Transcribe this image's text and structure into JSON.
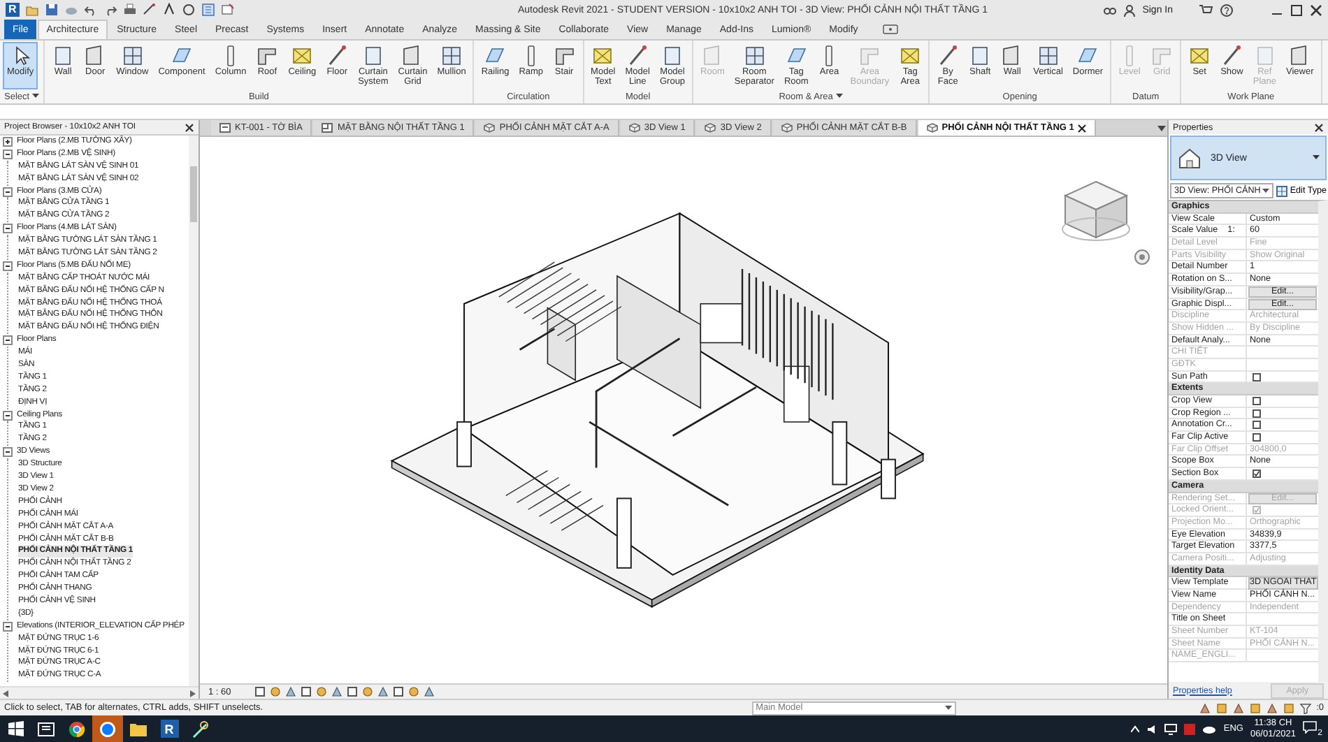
{
  "window": {
    "logo": "R",
    "title": "Autodesk Revit 2021 - STUDENT VERSION - 10x10x2 ANH TOI - 3D View: PHỐI CẢNH NỘI THẤT TẦNG 1",
    "sign_in": "Sign In"
  },
  "ribbon_tabs": [
    {
      "label": "File",
      "kind": "file",
      "selected": false
    },
    {
      "label": "Architecture",
      "kind": "tab",
      "selected": true
    },
    {
      "label": "Structure",
      "kind": "tab",
      "selected": false
    },
    {
      "label": "Steel",
      "kind": "tab",
      "selected": false
    },
    {
      "label": "Precast",
      "kind": "tab",
      "selected": false
    },
    {
      "label": "Systems",
      "kind": "tab",
      "selected": false
    },
    {
      "label": "Insert",
      "kind": "tab",
      "selected": false
    },
    {
      "label": "Annotate",
      "kind": "tab",
      "selected": false
    },
    {
      "label": "Analyze",
      "kind": "tab",
      "selected": false
    },
    {
      "label": "Massing & Site",
      "kind": "tab",
      "selected": false
    },
    {
      "label": "Collaborate",
      "kind": "tab",
      "selected": false
    },
    {
      "label": "View",
      "kind": "tab",
      "selected": false
    },
    {
      "label": "Manage",
      "kind": "tab",
      "selected": false
    },
    {
      "label": "Add-Ins",
      "kind": "tab",
      "selected": false
    },
    {
      "label": "Lumion®",
      "kind": "tab",
      "selected": false
    },
    {
      "label": "Modify",
      "kind": "tab",
      "selected": false
    }
  ],
  "ribbon_panels": [
    {
      "title": "Select",
      "menu": true,
      "tools": [
        {
          "label": "Modify",
          "selected": true,
          "disabled": false
        }
      ]
    },
    {
      "title": "Build",
      "menu": false,
      "tools": [
        {
          "label": "Wall",
          "selected": false,
          "disabled": false
        },
        {
          "label": "Door",
          "selected": false,
          "disabled": false
        },
        {
          "label": "Window",
          "selected": false,
          "disabled": false
        },
        {
          "label": "Component",
          "selected": false,
          "disabled": false
        },
        {
          "label": "Column",
          "selected": false,
          "disabled": false
        },
        {
          "label": "Roof",
          "selected": false,
          "disabled": false
        },
        {
          "label": "Ceiling",
          "selected": false,
          "disabled": false
        },
        {
          "label": "Floor",
          "selected": false,
          "disabled": false
        },
        {
          "label": "Curtain System",
          "selected": false,
          "disabled": false
        },
        {
          "label": "Curtain Grid",
          "selected": false,
          "disabled": false
        },
        {
          "label": "Mullion",
          "selected": false,
          "disabled": false
        }
      ]
    },
    {
      "title": "Circulation",
      "menu": false,
      "tools": [
        {
          "label": "Railing",
          "selected": false,
          "disabled": false
        },
        {
          "label": "Ramp",
          "selected": false,
          "disabled": false
        },
        {
          "label": "Stair",
          "selected": false,
          "disabled": false
        }
      ]
    },
    {
      "title": "Model",
      "menu": false,
      "tools": [
        {
          "label": "Model Text",
          "selected": false,
          "disabled": false
        },
        {
          "label": "Model Line",
          "selected": false,
          "disabled": false
        },
        {
          "label": "Model Group",
          "selected": false,
          "disabled": false
        }
      ]
    },
    {
      "title": "Room & Area",
      "menu": true,
      "tools": [
        {
          "label": "Room",
          "selected": false,
          "disabled": true
        },
        {
          "label": "Room Separator",
          "selected": false,
          "disabled": false
        },
        {
          "label": "Tag Room",
          "selected": false,
          "disabled": false
        },
        {
          "label": "Area",
          "selected": false,
          "disabled": false
        },
        {
          "label": "Area Boundary",
          "selected": false,
          "disabled": true
        },
        {
          "label": "Tag Area",
          "selected": false,
          "disabled": false
        }
      ]
    },
    {
      "title": "Opening",
      "menu": false,
      "tools": [
        {
          "label": "By Face",
          "selected": false,
          "disabled": false
        },
        {
          "label": "Shaft",
          "selected": false,
          "disabled": false
        },
        {
          "label": "Wall",
          "selected": false,
          "disabled": false
        },
        {
          "label": "Vertical",
          "selected": false,
          "disabled": false
        },
        {
          "label": "Dormer",
          "selected": false,
          "disabled": false
        }
      ]
    },
    {
      "title": "Datum",
      "menu": false,
      "tools": [
        {
          "label": "Level",
          "selected": false,
          "disabled": true
        },
        {
          "label": "Grid",
          "selected": false,
          "disabled": true
        }
      ]
    },
    {
      "title": "Work Plane",
      "menu": false,
      "tools": [
        {
          "label": "Set",
          "selected": false,
          "disabled": false
        },
        {
          "label": "Show",
          "selected": false,
          "disabled": false
        },
        {
          "label": "Ref Plane",
          "selected": false,
          "disabled": true
        },
        {
          "label": "Viewer",
          "selected": false,
          "disabled": false
        }
      ]
    }
  ],
  "project_browser": {
    "title": "Project Browser - 10x10x2 ANH TOI",
    "tree": [
      {
        "label": "Floor Plans (2.MB TƯỜNG XÂY)",
        "expanded": false,
        "selected": false
      },
      {
        "label": "Floor Plans (2.MB VỆ SINH)",
        "expanded": true,
        "selected": false,
        "children": [
          {
            "label": "MẶT BẰNG LÁT SÀN VỆ SINH 01",
            "selected": false
          },
          {
            "label": "MẶT BẰNG LÁT SÀN VỆ SINH 02",
            "selected": false
          }
        ]
      },
      {
        "label": "Floor Plans (3.MB CỬA)",
        "expanded": true,
        "selected": false,
        "children": [
          {
            "label": "MẶT BẰNG CỬA TẦNG 1",
            "selected": false
          },
          {
            "label": "MẶT BẰNG CỬA TẦNG 2",
            "selected": false
          }
        ]
      },
      {
        "label": "Floor Plans (4.MB LÁT SÀN)",
        "expanded": true,
        "selected": false,
        "children": [
          {
            "label": "MẶT BẰNG TƯỜNG LÁT SÀN TẦNG 1",
            "selected": false
          },
          {
            "label": "MẶT BẰNG TƯỜNG LÁT SÀN TẦNG 2",
            "selected": false
          }
        ]
      },
      {
        "label": "Floor Plans (5.MB ĐẤU NỐI ME)",
        "expanded": true,
        "selected": false,
        "children": [
          {
            "label": "MẶT BẰNG CẤP THOÁT NƯỚC MÁI",
            "selected": false
          },
          {
            "label": "MẶT BẰNG ĐẤU NỐI HỆ THỐNG CẤP N",
            "selected": false
          },
          {
            "label": "MẶT BẰNG ĐẤU NỐI HỆ THỐNG THOÁ",
            "selected": false
          },
          {
            "label": "MẶT BẰNG ĐẤU NỐI HỆ THỐNG THÔN",
            "selected": false
          },
          {
            "label": "MẶT BẰNG ĐẤU NỐI HỆ THỐNG ĐIỆN",
            "selected": false
          }
        ]
      },
      {
        "label": "Floor Plans",
        "expanded": true,
        "selected": false,
        "children": [
          {
            "label": "MÁI",
            "selected": false
          },
          {
            "label": "SÀN",
            "selected": false
          },
          {
            "label": "TẦNG 1",
            "selected": false
          },
          {
            "label": "TẦNG 2",
            "selected": false
          },
          {
            "label": "ĐỊNH VỊ",
            "selected": false
          }
        ]
      },
      {
        "label": "Ceiling Plans",
        "expanded": true,
        "selected": false,
        "children": [
          {
            "label": "TẦNG 1",
            "selected": false
          },
          {
            "label": "TẦNG 2",
            "selected": false
          }
        ]
      },
      {
        "label": "3D Views",
        "expanded": true,
        "selected": false,
        "children": [
          {
            "label": "3D Structure",
            "selected": false
          },
          {
            "label": "3D View 1",
            "selected": false
          },
          {
            "label": "3D View 2",
            "selected": false
          },
          {
            "label": "PHỐI CẢNH",
            "selected": false
          },
          {
            "label": "PHỐI CẢNH MÁI",
            "selected": false
          },
          {
            "label": "PHỐI CẢNH MẶT CẮT A-A",
            "selected": false
          },
          {
            "label": "PHỐI CẢNH MẶT CẮT B-B",
            "selected": false
          },
          {
            "label": "PHỐI CẢNH NỘI THẤT TẦNG 1",
            "selected": true
          },
          {
            "label": "PHỐI CẢNH NỘI THẤT TẦNG 2",
            "selected": false
          },
          {
            "label": "PHỐI CẢNH TAM CẤP",
            "selected": false
          },
          {
            "label": "PHỐI CẢNH THANG",
            "selected": false
          },
          {
            "label": "PHỐI CẢNH VỆ SINH",
            "selected": false
          },
          {
            "label": "{3D}",
            "selected": false
          }
        ]
      },
      {
        "label": "Elevations (INTERIOR_ELEVATION CẤP PHÉP",
        "expanded": true,
        "selected": false,
        "children": [
          {
            "label": "MẶT ĐỨNG TRỤC 1-6",
            "selected": false
          },
          {
            "label": "MẶT ĐỨNG TRỤC 6-1",
            "selected": false
          },
          {
            "label": "MẶT ĐỨNG TRỤC A-C",
            "selected": false
          },
          {
            "label": "MẶT ĐỨNG TRỤC C-A",
            "selected": false
          }
        ]
      }
    ]
  },
  "view_tabs": [
    {
      "label": "KT-001 - TỜ BÌA",
      "kind": "sheet",
      "selected": false
    },
    {
      "label": "MẶT BẰNG NỘI THẤT TẦNG 1",
      "kind": "plan",
      "selected": false
    },
    {
      "label": "PHỐI CẢNH MẶT CẮT A-A",
      "kind": "model",
      "selected": false
    },
    {
      "label": "3D View 1",
      "kind": "model",
      "selected": false
    },
    {
      "label": "3D View 2",
      "kind": "model",
      "selected": false
    },
    {
      "label": "PHỐI CẢNH MẶT CẮT B-B",
      "kind": "model",
      "selected": false
    },
    {
      "label": "PHỐI CẢNH NỘI THẤT TẦNG 1",
      "kind": "model",
      "selected": true
    }
  ],
  "view_control_bar": {
    "scale": "1 : 60"
  },
  "properties": {
    "title": "Properties",
    "type": "3D View",
    "selector": "3D View: PHỐI CẢNH",
    "edit_type": "Edit Type",
    "groups": [
      {
        "title": "Graphics",
        "rows": [
          {
            "name": "View Scale",
            "value": "Custom",
            "kind": "text",
            "disabled": false
          },
          {
            "name": "Scale Value    1:",
            "value": "60",
            "kind": "text",
            "disabled": false
          },
          {
            "name": "Detail Level",
            "value": "Fine",
            "kind": "text",
            "disabled": true
          },
          {
            "name": "Parts Visibility",
            "value": "Show Original",
            "kind": "text",
            "disabled": true
          },
          {
            "name": "Detail Number",
            "value": "1",
            "kind": "text",
            "disabled": false
          },
          {
            "name": "Rotation on S...",
            "value": "None",
            "kind": "text",
            "disabled": false
          },
          {
            "name": "Visibility/Grap...",
            "value": "Edit...",
            "kind": "button",
            "disabled": false
          },
          {
            "name": "Graphic Displ...",
            "value": "Edit...",
            "kind": "button",
            "disabled": false
          },
          {
            "name": "Discipline",
            "value": "Architectural",
            "kind": "text",
            "disabled": true
          },
          {
            "name": "Show Hidden ...",
            "value": "By Discipline",
            "kind": "text",
            "disabled": true
          },
          {
            "name": "Default Analy...",
            "value": "None",
            "kind": "text",
            "disabled": false
          },
          {
            "name": "CHI TIẾT",
            "kind": "text",
            "disabled": true
          },
          {
            "name": "GĐTK",
            "kind": "text",
            "disabled": true
          },
          {
            "name": "Sun Path",
            "kind": "checkbox",
            "checked": false,
            "disabled": false
          }
        ]
      },
      {
        "title": "Extents",
        "rows": [
          {
            "name": "Crop View",
            "kind": "checkbox",
            "checked": false,
            "disabled": false
          },
          {
            "name": "Crop Region ...",
            "kind": "checkbox",
            "checked": false,
            "disabled": false
          },
          {
            "name": "Annotation Cr...",
            "kind": "checkbox",
            "checked": false,
            "disabled": false
          },
          {
            "name": "Far Clip Active",
            "kind": "checkbox",
            "checked": false,
            "disabled": false
          },
          {
            "name": "Far Clip Offset",
            "value": "304800,0",
            "kind": "text",
            "disabled": true
          },
          {
            "name": "Scope Box",
            "value": "None",
            "kind": "text",
            "disabled": false
          },
          {
            "name": "Section Box",
            "kind": "checkbox",
            "checked": true,
            "disabled": false
          }
        ]
      },
      {
        "title": "Camera",
        "rows": [
          {
            "name": "Rendering Set...",
            "value": "Edit...",
            "kind": "button",
            "disabled": true
          },
          {
            "name": "Locked Orient...",
            "kind": "checkbox",
            "checked": true,
            "disabled": true
          },
          {
            "name": "Projection Mo...",
            "value": "Orthographic",
            "kind": "text",
            "disabled": true
          },
          {
            "name": "Eye Elevation",
            "value": "34839,9",
            "kind": "text",
            "disabled": false
          },
          {
            "name": "Target Elevation",
            "value": "3377,5",
            "kind": "text",
            "disabled": false
          },
          {
            "name": "Camera Positi...",
            "value": "Adjusting",
            "kind": "text",
            "disabled": true
          }
        ]
      },
      {
        "title": "Identity Data",
        "rows": [
          {
            "name": "View Template",
            "value": "3D NGOAI THAT",
            "kind": "button",
            "disabled": false
          },
          {
            "name": "View Name",
            "value": "PHỐI CẢNH N...",
            "kind": "text",
            "disabled": false
          },
          {
            "name": "Dependency",
            "value": "Independent",
            "kind": "text",
            "disabled": true
          },
          {
            "name": "Title on Sheet",
            "kind": "text",
            "disabled": false
          },
          {
            "name": "Sheet Number",
            "value": "KT-104",
            "kind": "text",
            "disabled": true
          },
          {
            "name": "Sheet Name",
            "value": "PHỐI CẢNH N...",
            "kind": "text",
            "disabled": true
          },
          {
            "name": "NAME_ENGLI...",
            "kind": "text",
            "disabled": true
          }
        ]
      }
    ],
    "help": "Properties help",
    "apply": "Apply"
  },
  "status_bar": {
    "message": "Click to select, TAB for alternates, CTRL adds, SHIFT unselects.",
    "workset": "Main Model",
    "filter_count": ":0"
  },
  "taskbar": {
    "app_logo": "R",
    "language": "ENG",
    "time": "11:38 CH",
    "date": "06/01/2021",
    "notifications": "2"
  }
}
